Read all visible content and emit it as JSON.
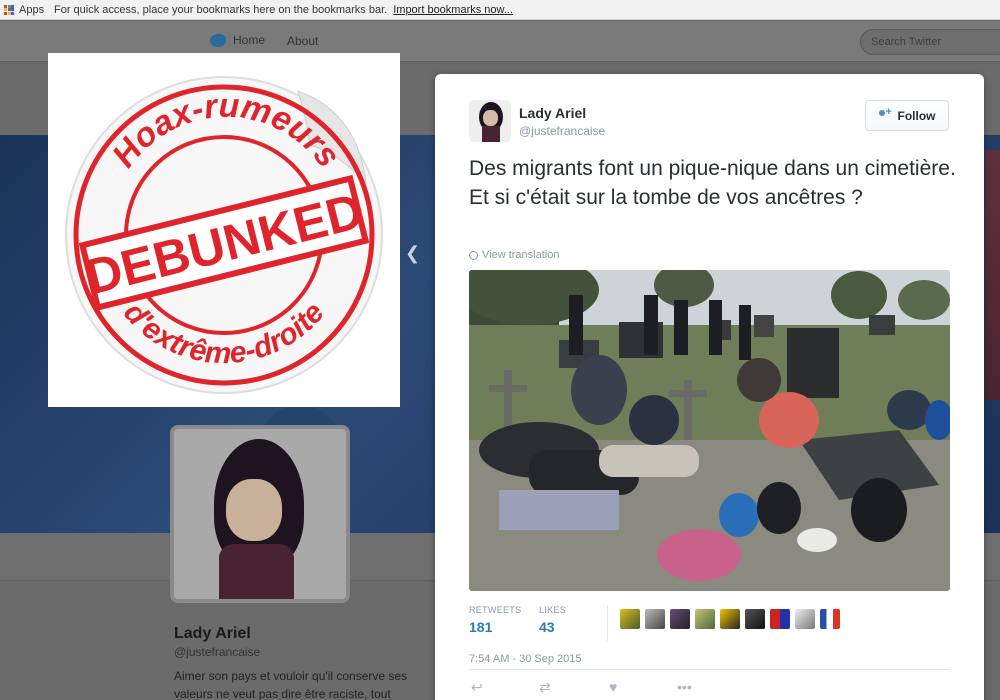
{
  "browser": {
    "apps_label": "Apps",
    "bookmarks_message": "For quick access, place your bookmarks here on the bookmarks bar.",
    "import_link": "Import bookmarks now..."
  },
  "twitter_nav": {
    "home": "Home",
    "about": "About",
    "search_placeholder": "Search Twitter"
  },
  "sticker": {
    "top_arc": "Hoax-rumeurs",
    "banner": "DEBUNKED",
    "bottom_arc": "d'extrême-droite",
    "color": "#e0242b"
  },
  "profile": {
    "name": "Lady Ariel",
    "handle": "@justefrancaise",
    "bio": "Aimer son pays et vouloir qu'il conserve ses valeurs ne veut pas dire être raciste, tout"
  },
  "tweet": {
    "author_name": "Lady Ariel",
    "author_handle": "@justefrancaise",
    "follow_label": "Follow",
    "text": "Des migrants font un pique-nique dans un cimetière. Et si c'était sur la tombe de vos ancêtres ?",
    "view_translation": "View translation",
    "retweets_label": "RETWEETS",
    "retweets_count": "181",
    "likes_label": "LIKES",
    "likes_count": "43",
    "timestamp": "7:54 AM - 30 Sep 2015",
    "accent_color": "#2b7bb9"
  }
}
